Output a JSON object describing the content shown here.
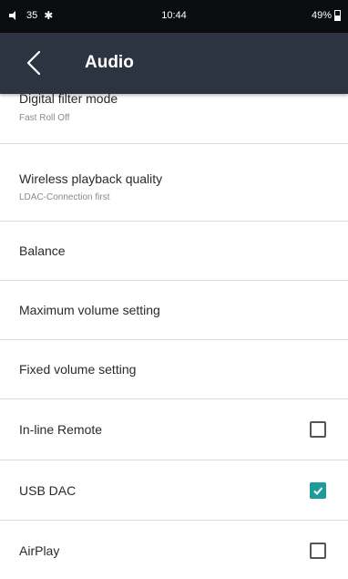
{
  "status_bar": {
    "volume": "35",
    "time": "10:44",
    "battery": "49%"
  },
  "app_bar": {
    "title": "Audio"
  },
  "settings": {
    "digital_filter": {
      "title": "Digital filter mode",
      "value": "Fast Roll Off"
    },
    "wireless_quality": {
      "title": "Wireless playback quality",
      "value": "LDAC-Connection first"
    },
    "balance": {
      "title": "Balance"
    },
    "max_volume": {
      "title": "Maximum volume setting"
    },
    "fixed_volume": {
      "title": "Fixed volume setting"
    },
    "inline_remote": {
      "title": "In-line Remote",
      "checked": false
    },
    "usb_dac": {
      "title": "USB DAC",
      "checked": true
    },
    "airplay": {
      "title": "AirPlay",
      "checked": false
    }
  },
  "colors": {
    "status_bar_bg": "#0a0c0e",
    "app_bar_bg": "#2b3440",
    "accent": "#1d9b9a"
  }
}
